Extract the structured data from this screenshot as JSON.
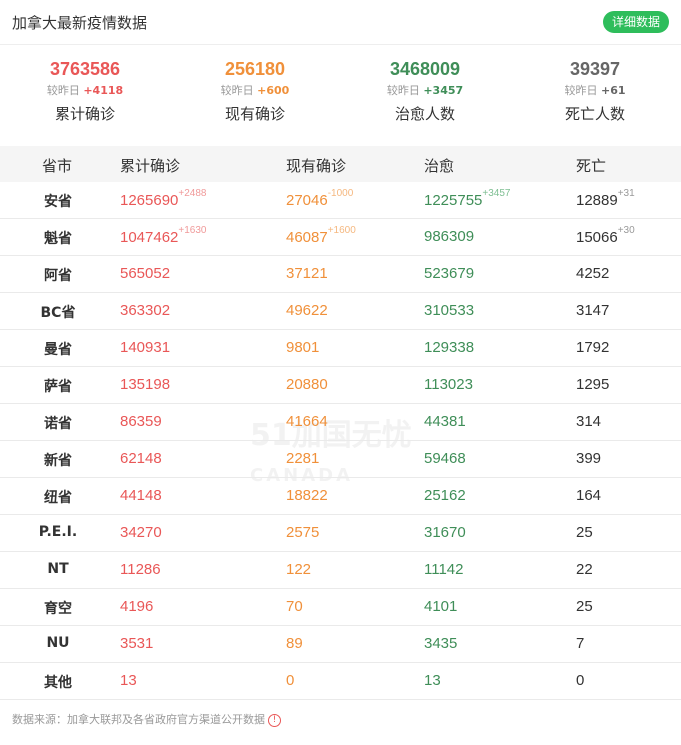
{
  "header": {
    "title": "加拿大最新疫情数据",
    "detail_button": "详细数据"
  },
  "summary": [
    {
      "value": "3763586",
      "sub_label": "较昨日",
      "delta": "+4118",
      "label": "累计确诊",
      "color": "#e95757"
    },
    {
      "value": "256180",
      "sub_label": "较昨日",
      "delta": "+600",
      "label": "现有确诊",
      "color": "#f0903a"
    },
    {
      "value": "3468009",
      "sub_label": "较昨日",
      "delta": "+3457",
      "label": "治愈人数",
      "color": "#3f8e58"
    },
    {
      "value": "39397",
      "sub_label": "较昨日",
      "delta": "+61",
      "label": "死亡人数",
      "color": "#666666"
    }
  ],
  "table": {
    "headers": [
      "省市",
      "累计确诊",
      "现有确诊",
      "治愈",
      "死亡"
    ],
    "rows": [
      {
        "province": "安省",
        "confirmed": "1265690",
        "confirmed_delta": "+2488",
        "active": "27046",
        "active_delta": "-1000",
        "recovered": "1225755",
        "recovered_delta": "+3457",
        "deaths": "12889",
        "deaths_delta": "+31"
      },
      {
        "province": "魁省",
        "confirmed": "1047462",
        "confirmed_delta": "+1630",
        "active": "46087",
        "active_delta": "+1600",
        "recovered": "986309",
        "recovered_delta": "",
        "deaths": "15066",
        "deaths_delta": "+30"
      },
      {
        "province": "阿省",
        "confirmed": "565052",
        "confirmed_delta": "",
        "active": "37121",
        "active_delta": "",
        "recovered": "523679",
        "recovered_delta": "",
        "deaths": "4252",
        "deaths_delta": ""
      },
      {
        "province": "BC省",
        "confirmed": "363302",
        "confirmed_delta": "",
        "active": "49622",
        "active_delta": "",
        "recovered": "310533",
        "recovered_delta": "",
        "deaths": "3147",
        "deaths_delta": ""
      },
      {
        "province": "曼省",
        "confirmed": "140931",
        "confirmed_delta": "",
        "active": "9801",
        "active_delta": "",
        "recovered": "129338",
        "recovered_delta": "",
        "deaths": "1792",
        "deaths_delta": ""
      },
      {
        "province": "萨省",
        "confirmed": "135198",
        "confirmed_delta": "",
        "active": "20880",
        "active_delta": "",
        "recovered": "113023",
        "recovered_delta": "",
        "deaths": "1295",
        "deaths_delta": ""
      },
      {
        "province": "诺省",
        "confirmed": "86359",
        "confirmed_delta": "",
        "active": "41664",
        "active_delta": "",
        "recovered": "44381",
        "recovered_delta": "",
        "deaths": "314",
        "deaths_delta": ""
      },
      {
        "province": "新省",
        "confirmed": "62148",
        "confirmed_delta": "",
        "active": "2281",
        "active_delta": "",
        "recovered": "59468",
        "recovered_delta": "",
        "deaths": "399",
        "deaths_delta": ""
      },
      {
        "province": "纽省",
        "confirmed": "44148",
        "confirmed_delta": "",
        "active": "18822",
        "active_delta": "",
        "recovered": "25162",
        "recovered_delta": "",
        "deaths": "164",
        "deaths_delta": ""
      },
      {
        "province": "P.E.I.",
        "confirmed": "34270",
        "confirmed_delta": "",
        "active": "2575",
        "active_delta": "",
        "recovered": "31670",
        "recovered_delta": "",
        "deaths": "25",
        "deaths_delta": ""
      },
      {
        "province": "NT",
        "confirmed": "11286",
        "confirmed_delta": "",
        "active": "122",
        "active_delta": "",
        "recovered": "11142",
        "recovered_delta": "",
        "deaths": "22",
        "deaths_delta": ""
      },
      {
        "province": "育空",
        "confirmed": "4196",
        "confirmed_delta": "",
        "active": "70",
        "active_delta": "",
        "recovered": "4101",
        "recovered_delta": "",
        "deaths": "25",
        "deaths_delta": ""
      },
      {
        "province": "NU",
        "confirmed": "3531",
        "confirmed_delta": "",
        "active": "89",
        "active_delta": "",
        "recovered": "3435",
        "recovered_delta": "",
        "deaths": "7",
        "deaths_delta": ""
      },
      {
        "province": "其他",
        "confirmed": "13",
        "confirmed_delta": "",
        "active": "0",
        "active_delta": "",
        "recovered": "13",
        "recovered_delta": "",
        "deaths": "0",
        "deaths_delta": ""
      }
    ]
  },
  "footer": {
    "source": "数据来源：加拿大联邦及各省政府官方渠道公开数据",
    "info_icon": "info-icon"
  },
  "watermark": {
    "brand": "51加国无忧",
    "sub": "CANADA",
    "logo_mark": "51"
  }
}
